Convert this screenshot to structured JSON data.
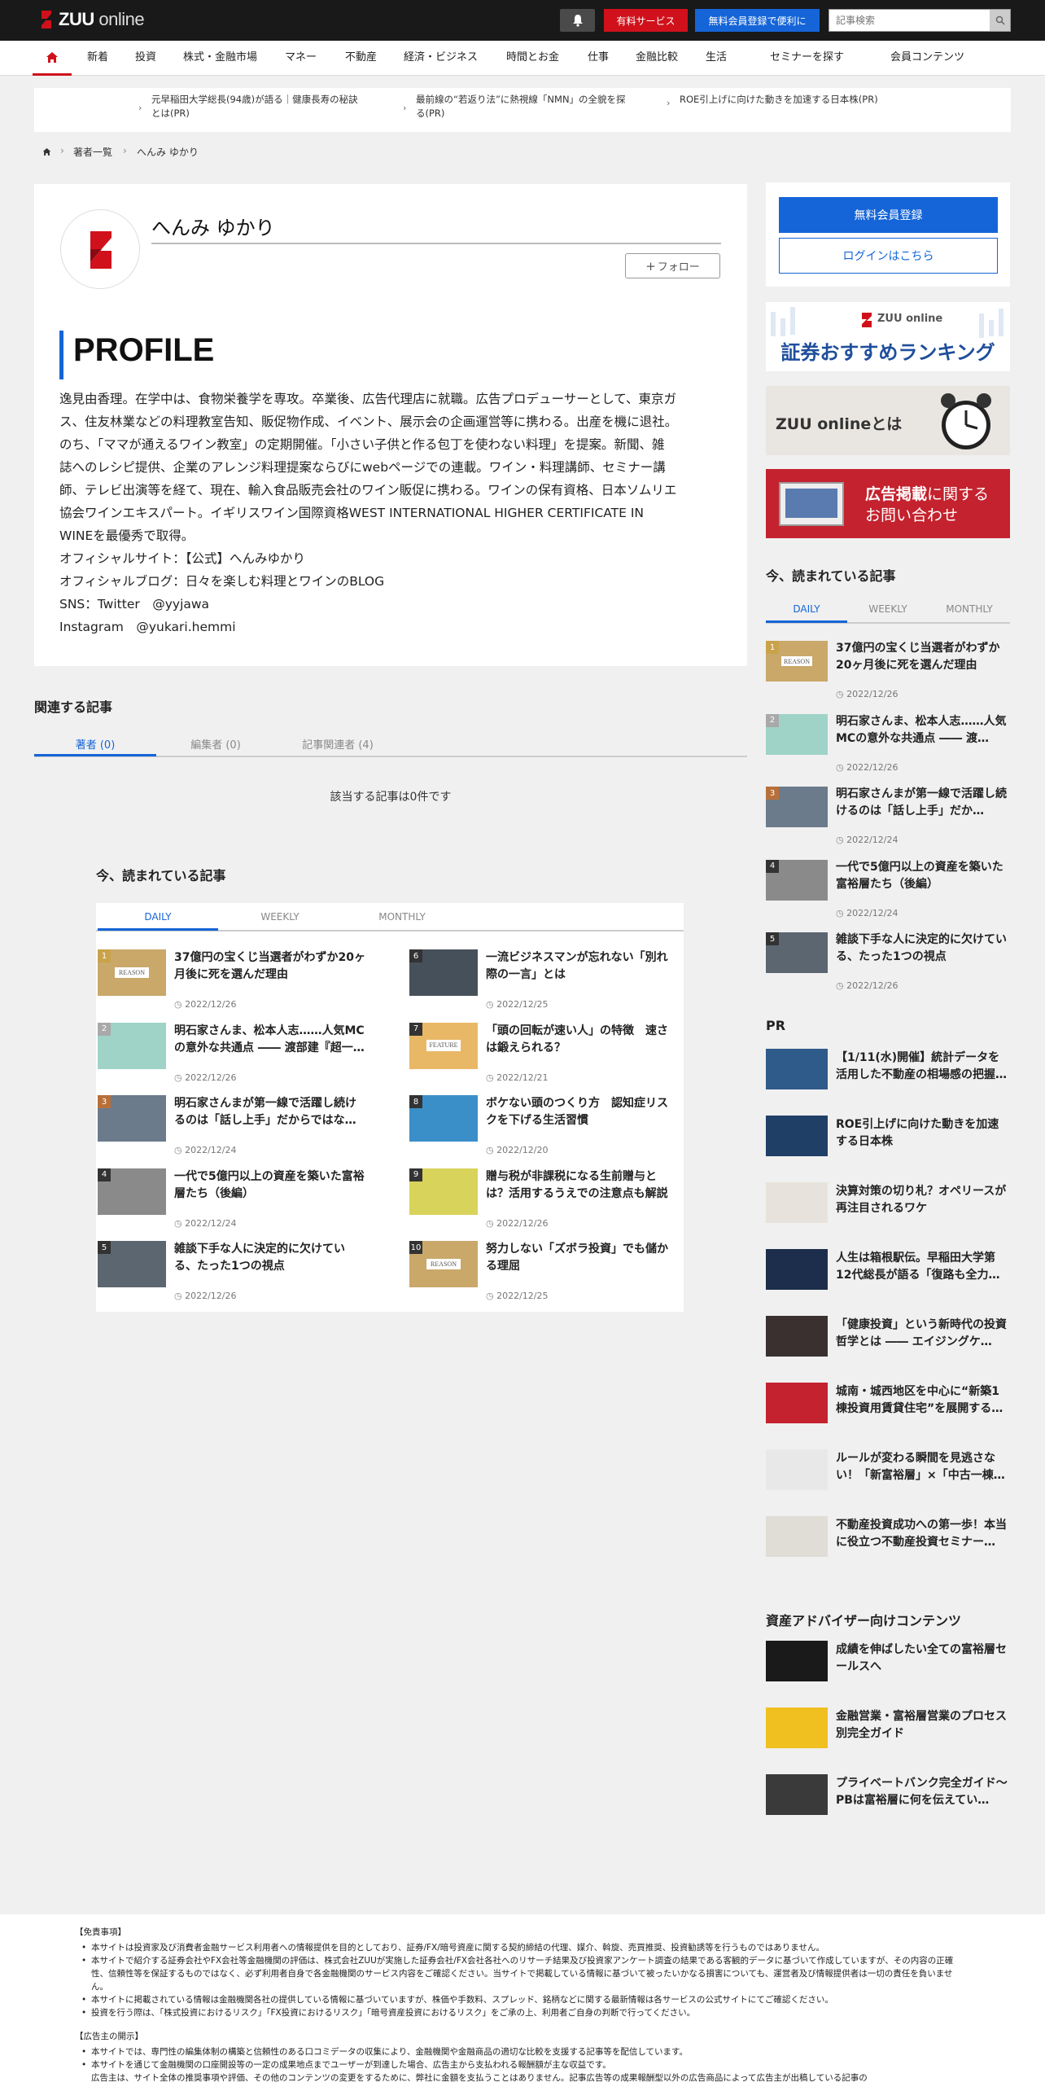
{
  "header": {
    "logo_brand": "ZUU",
    "logo_suffix": "online",
    "paid_service": "有料サービス",
    "free_register": "無料会員登録で便利に",
    "search_placeholder": "記事検索"
  },
  "nav": {
    "items": [
      "新着",
      "投資",
      "株式・金融市場",
      "マネー",
      "不動産",
      "経済・ビジネス",
      "時間とお金",
      "仕事",
      "金融比較",
      "生活",
      "セミナーを探す",
      "会員コンテンツ"
    ]
  },
  "banner": [
    {
      "line1": "元早稲田大学総長(94歳)が語る｜健康長寿の秘訣",
      "line2": "とは(PR)"
    },
    {
      "line1": "最前線の“若返り法”に熱視線「NMN」の全貌を探",
      "line2": "る(PR)"
    },
    {
      "line1": "ROE引上げに向けた動きを加速する日本株(PR)",
      "line2": ""
    }
  ],
  "breadcrumb": {
    "list": "著者一覧",
    "current": "へんみ ゆかり"
  },
  "profile": {
    "name": "へんみ ゆかり",
    "follow": "フォロー",
    "heading": "PROFILE",
    "bio_lines": [
      "逸見由香理。在学中は、食物栄養学を専攻。卒業後、広告代理店に就職。広告プロデューサーとして、東京ガ",
      "ス、住友林業などの料理教室告知、販促物作成、イベント、展示会の企画運営等に携わる。出産を機に退社。",
      "のち、「ママが通えるワイン教室」の定期開催。「小さい子供と作る包丁を使わない料理」を提案。新聞、雑",
      "誌へのレシピ提供、企業のアレンジ料理提案ならびにwebページでの連載。ワイン・料理講師、セミナー講",
      "師、テレビ出演等を経て、現在、輸入食品販売会社のワイン販促に携わる。ワインの保有資格、日本ソムリエ",
      "協会ワインエキスパート。イギリスワイン国際資格WEST INTERNATIONAL HIGHER CERTIFICATE IN",
      "WINEを最優秀で取得。",
      "オフィシャルサイト：【公式】へんみゆかり",
      "オフィシャルブログ：日々を楽しむ料理とワインのBLOG",
      "SNS：Twitter　@yyjawa",
      "Instagram　@yukari.hemmi"
    ]
  },
  "related": {
    "title": "関連する記事",
    "tabs": [
      "著者 (0)",
      "編集者 (0)",
      "記事関連者 (4)"
    ],
    "empty": "該当する記事は0件です"
  },
  "ranking_main": {
    "title": "今、読まれている記事",
    "tabs": [
      "DAILY",
      "WEEKLY",
      "MONTHLY"
    ],
    "items": [
      {
        "rank": "1",
        "title": "37億円の宝くじ当選者がわずか20ヶ月後に死を選んだ理由",
        "date": "2022/12/26"
      },
      {
        "rank": "2",
        "title": "明石家さんま、松本人志……人気MCの意外な共通点 ―― 渡部建『超一…",
        "date": "2022/12/26"
      },
      {
        "rank": "3",
        "title": "明石家さんまが第一線で活躍し続けるのは「話し上手」だからではな…",
        "date": "2022/12/24"
      },
      {
        "rank": "4",
        "title": "一代で5億円以上の資産を築いた富裕層たち（後編）",
        "date": "2022/12/24"
      },
      {
        "rank": "5",
        "title": "雑談下手な人に決定的に欠けている、たった1つの視点",
        "date": "2022/12/26"
      },
      {
        "rank": "6",
        "title": "一流ビジネスマンが忘れない「別れ際の一言」とは",
        "date": "2022/12/25"
      },
      {
        "rank": "7",
        "title": "「頭の回転が速い人」の特徴　速さは鍛えられる？",
        "date": "2022/12/21"
      },
      {
        "rank": "8",
        "title": "ボケない頭のつくり方　認知症リスクを下げる生活習慣",
        "date": "2022/12/20"
      },
      {
        "rank": "9",
        "title": "贈与税が非課税になる生前贈与とは？活用するうえでの注意点も解説",
        "date": "2022/12/26"
      },
      {
        "rank": "10",
        "title": "努力しない「ズボラ投資」でも儲かる理屈",
        "date": "2022/12/25"
      }
    ]
  },
  "sidebar": {
    "register": "無料会員登録",
    "login": "ログインはこちら",
    "banner1_brand": "ZUU online",
    "banner1_text": "証券おすすめランキング",
    "banner2_text": "ZUU onlineとは",
    "banner3_text1": "広告掲載",
    "banner3_text2": "に関する",
    "banner3_text3": "お問い合わせ",
    "ranking_title": "今、読まれている記事",
    "ranking_tabs": [
      "DAILY",
      "WEEKLY",
      "MONTHLY"
    ],
    "ranking_items": [
      {
        "rank": "1",
        "title": "37億円の宝くじ当選者がわずか20ヶ月後に死を選んだ理由",
        "date": "2022/12/26"
      },
      {
        "rank": "2",
        "title": "明石家さんま、松本人志……人気MCの意外な共通点 ―― 渡…",
        "date": "2022/12/26"
      },
      {
        "rank": "3",
        "title": "明石家さんまが第一線で活躍し続けるのは「話し上手」だか…",
        "date": "2022/12/24"
      },
      {
        "rank": "4",
        "title": "一代で5億円以上の資産を築いた富裕層たち（後編）",
        "date": "2022/12/24"
      },
      {
        "rank": "5",
        "title": "雑談下手な人に決定的に欠けている、たった1つの視点",
        "date": "2022/12/26"
      }
    ],
    "pr_title": "PR",
    "pr_items": [
      "【1/11(水)開催】統計データを活用した不動産の相場感の把握…",
      "ROE引上げに向けた動きを加速する日本株",
      "決算対策の切り札？オペリースが再注目されるワケ",
      "人生は箱根駅伝。早稲田大学第12代総長が語る「復路も全力…",
      "「健康投資」という新時代の投資哲学とは ―― エイジングケ…",
      "城南・城西地区を中心に“新築1棟投資用賃貸住宅”を展開する…",
      "ルールが変わる瞬間を見逃さない！「新富裕層」×「中古一棟…",
      "不動産投資成功への第一歩！本当に役立つ不動産投資セミナー…"
    ],
    "advisor_title": "資産アドバイザー向けコンテンツ",
    "advisor_items": [
      "成績を伸ばしたい全ての富裕層セールスへ",
      "金融営業・富裕層営業のプロセス別完全ガイド",
      "プライベートバンク完全ガイド〜PBは富裕層に何を伝えてい…"
    ]
  },
  "footer": {
    "disclaimer_title": "【免責事項】",
    "disclaimer": [
      "本サイトは投資家及び消費者金融サービス利用者への情報提供を目的としており、証券/FX/暗号資産に関する契約締結の代理、媒介、斡旋、売買推奨、投資勧誘等を行うものではありません。",
      "本サイトで紹介する証券会社やFX会社等金融機関の評価は、株式会社ZUUが実施した証券会社/FX会社各社へのリサーチ結果及び投資家アンケート調査の結果である客観的データに基づいて作成していますが、その内容の正確性、信頼性等を保証するものではなく、必ず利用者自身で各金融機関のサービス内容をご確認ください。当サイトで掲載している情報に基づいて被ったいかなる損害についても、運営者及び情報提供者は一切の責任を負いません。",
      "本サイトに掲載されている情報は金融機関各社の提供している情報に基づいていますが、株価や手数料、スプレッド、銘柄などに関する最新情報は各サービスの公式サイトにてご確認ください。",
      "投資を行う際は、「株式投資におけるリスク」「FX投資におけるリスク」「暗号資産投資におけるリスク」をご承の上、利用者ご自身の判断で行ってください。"
    ],
    "ad_title": "【広告主の開示】",
    "ad": [
      "本サイトでは、専門性の編集体制の構築と信頼性のある口コミデータの収集により、金融機関や金融商品の適切な比較を支援する記事等を配信しています。",
      "本サイトを通じて金融機関の口座開設等の一定の成果地点までユーザーが到達した場合、広告主から支払われる報酬額が主な収益です。",
      "広告主は、サイト全体の推奨事項や評価、その他のコンテンツの変更をするために、弊社に金額を支払うことはありません。記事広告等の成果報酬型以外の広告商品によって広告主が出稿している記事の"
    ]
  },
  "colors": {
    "brand_red": "#d0111b",
    "accent_blue": "#1565d8",
    "header_bg": "#191919"
  }
}
